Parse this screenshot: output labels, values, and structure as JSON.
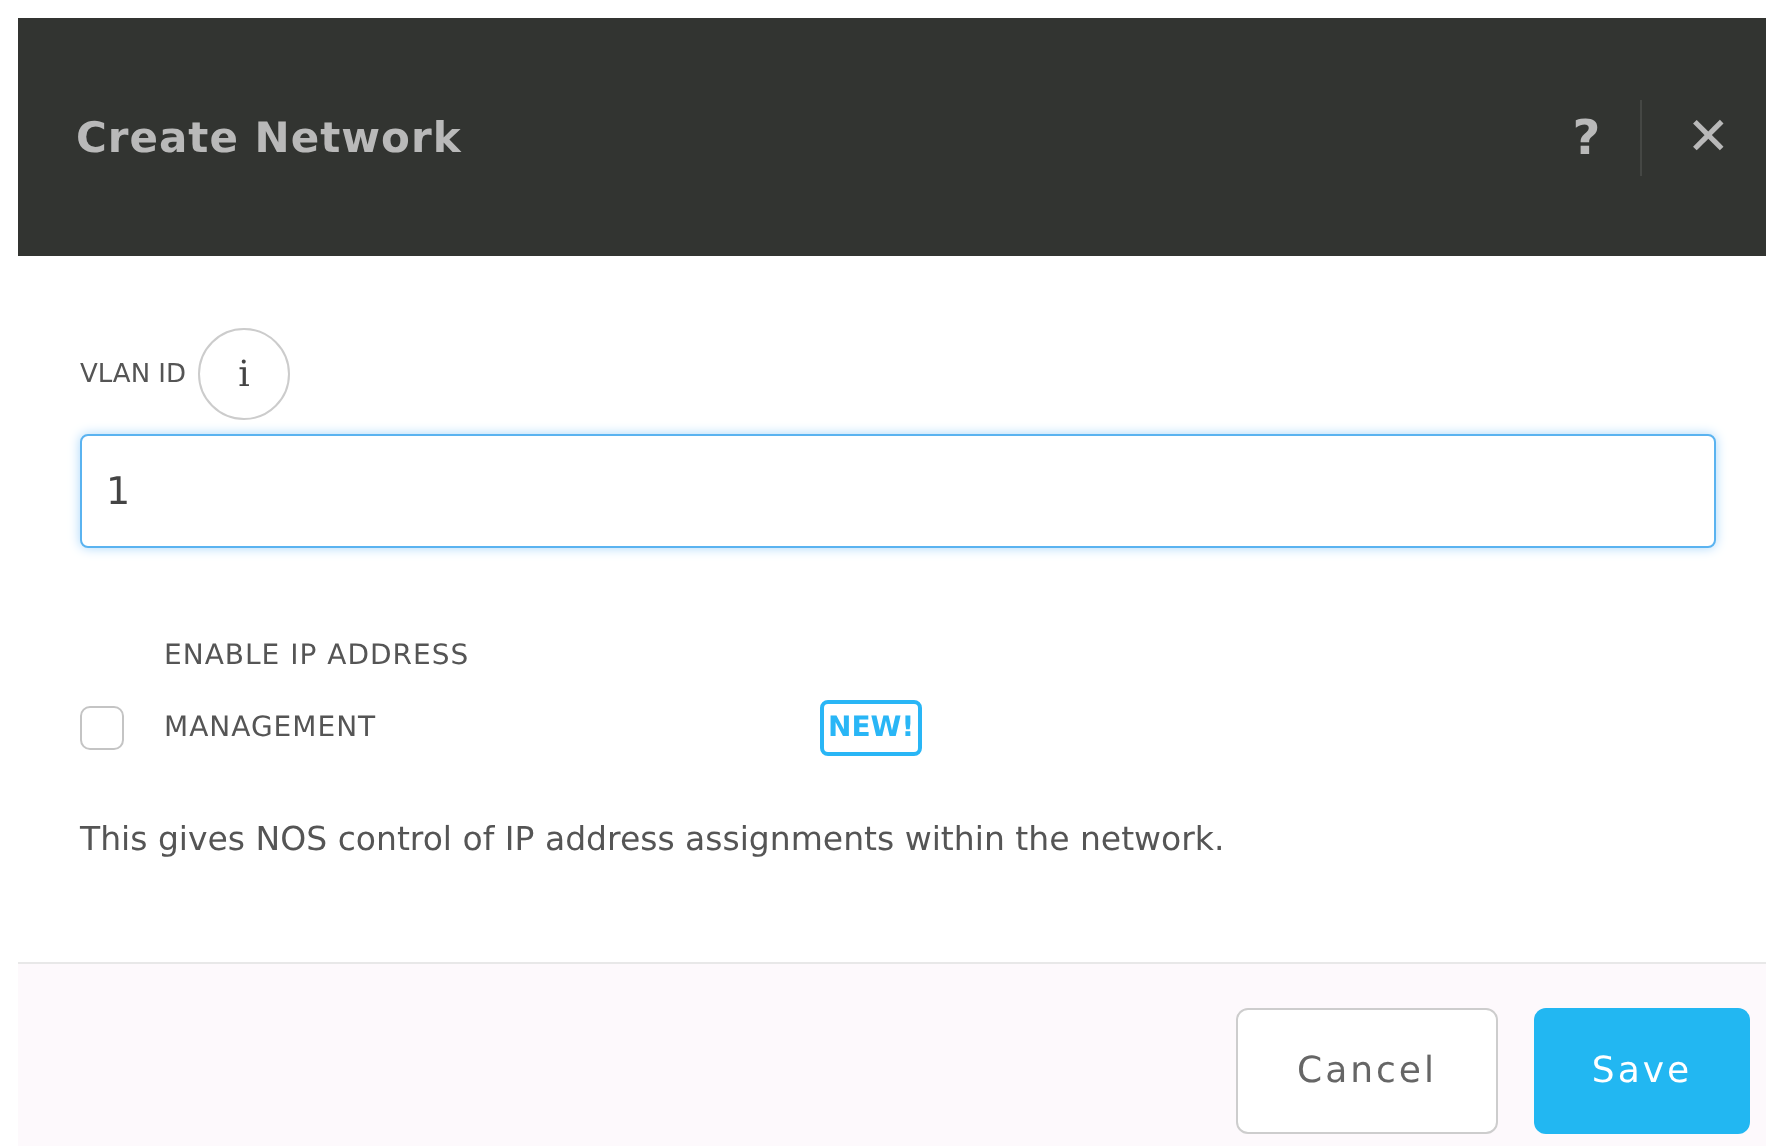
{
  "window": {
    "title": "Create Network"
  },
  "header_actions": [
    {
      "kind": "help",
      "label": "?"
    },
    {
      "kind": "close",
      "label": "✕"
    }
  ],
  "vlan_field": {
    "label": "VLAN ID",
    "info": "i",
    "value": "1",
    "focused": true
  },
  "ip_management": {
    "label_line1": "ENABLE IP ADDRESS",
    "label_line2": "MANAGEMENT",
    "checked": false,
    "badge": "NEW!"
  },
  "description": "This gives NOS control of IP address assignments within the network.",
  "buttons": [
    {
      "kind": "secondary",
      "label": "Cancel"
    },
    {
      "kind": "primary",
      "label": "Save"
    }
  ]
}
